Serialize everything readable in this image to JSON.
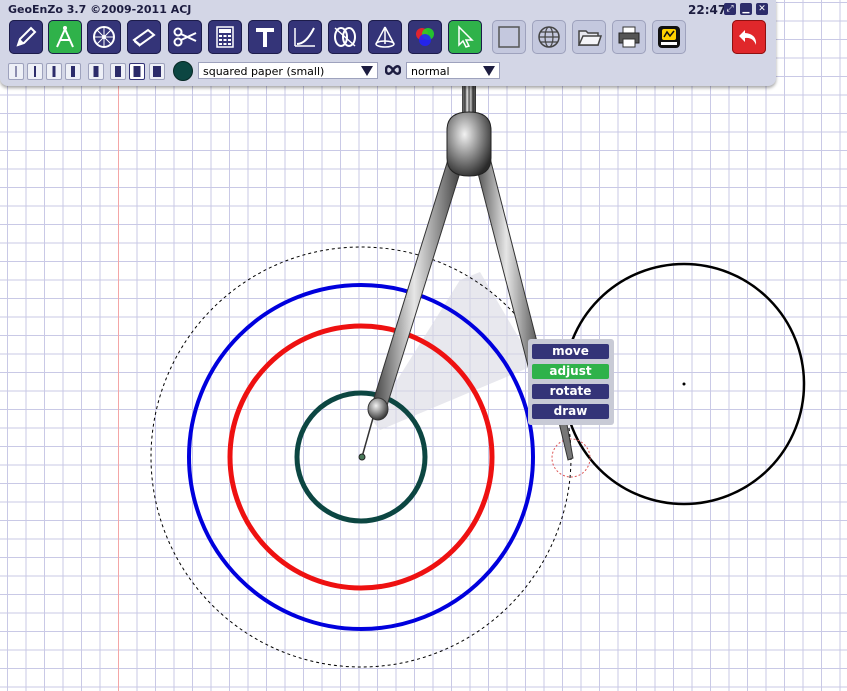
{
  "app": {
    "title": "GeoEnZo 3.7 ©2009-2011 ACJ",
    "clock": "22:47"
  },
  "window_buttons": [
    {
      "name": "maximize-button",
      "glyph": "⤢"
    },
    {
      "name": "minimize-button",
      "glyph": "▁"
    },
    {
      "name": "close-button",
      "glyph": "✕"
    }
  ],
  "toolbar": {
    "tools": [
      {
        "name": "pencil-tool",
        "icon": "pencil-icon",
        "active": false
      },
      {
        "name": "compass-tool",
        "icon": "compass-icon",
        "active": true
      },
      {
        "name": "protractor-tool",
        "icon": "protractor-icon",
        "active": false
      },
      {
        "name": "eraser-tool",
        "icon": "eraser-icon",
        "active": false
      },
      {
        "name": "scissors-tool",
        "icon": "scissors-icon",
        "active": false
      },
      {
        "name": "calculator-tool",
        "icon": "calculator-icon",
        "active": false
      },
      {
        "name": "text-tool",
        "icon": "text-icon",
        "active": false
      },
      {
        "name": "curve-tool",
        "icon": "curve-icon",
        "active": false
      },
      {
        "name": "intersection-tool",
        "icon": "intersection-icon",
        "active": false
      },
      {
        "name": "solid-tool",
        "icon": "cone-icon",
        "active": false
      },
      {
        "name": "color-tool",
        "icon": "color-wheel-icon",
        "active": false
      },
      {
        "name": "select-tool",
        "icon": "cursor-arrow-icon",
        "active": true
      },
      {
        "name": "frame-tool",
        "icon": "frame-icon",
        "active": false
      },
      {
        "name": "globe-tool",
        "icon": "globe-icon",
        "active": false
      },
      {
        "name": "open-tool",
        "icon": "folder-icon",
        "active": false
      },
      {
        "name": "print-tool",
        "icon": "printer-icon",
        "active": false
      },
      {
        "name": "mathdraw-tool",
        "icon": "mathdraw-logo-icon",
        "active": false
      },
      {
        "name": "undo-tool",
        "icon": "undo-arrow-icon",
        "active": false
      }
    ],
    "line_thickness_count": 8,
    "selected_thickness_index": 6,
    "current_color": "#0c4642",
    "paper": {
      "value": "squared paper (small)"
    },
    "line_style": {
      "value": "normal"
    }
  },
  "context_menu": {
    "items": [
      {
        "label": "move",
        "active": false
      },
      {
        "label": "adjust",
        "active": true
      },
      {
        "label": "rotate",
        "active": false
      },
      {
        "label": "draw",
        "active": false
      }
    ]
  },
  "colors": {
    "toolbar_bg": "#d3d6e6",
    "tool_button": "#343478",
    "active_tool": "#2fb24a",
    "undo_button": "#e0272b",
    "circle_dark_teal": "#0c4642",
    "circle_red": "#ee1111",
    "circle_blue": "#0000dd",
    "circle_black": "#000000"
  }
}
